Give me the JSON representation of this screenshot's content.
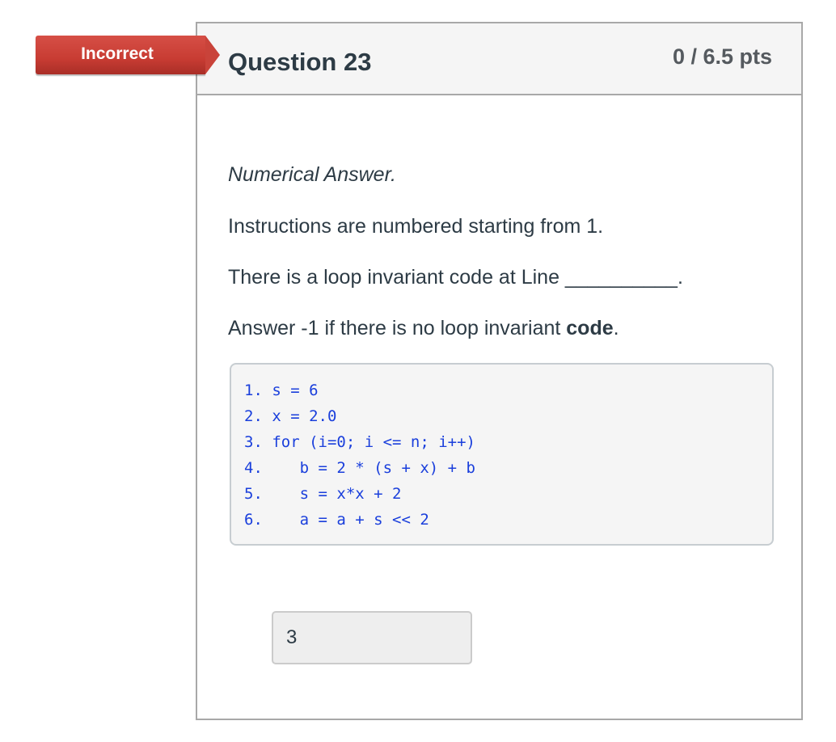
{
  "status": {
    "label": "Incorrect",
    "color": "#c83c33"
  },
  "question": {
    "title": "Question 23",
    "points": "0 / 6.5 pts",
    "type_label": "Numerical Answer.",
    "instructions": "Instructions are numbered starting from 1.",
    "prompt": "There is a loop invariant code at Line __________.",
    "note_prefix": "Answer -1 if there is no loop invariant ",
    "note_bold": "code",
    "note_suffix": ".",
    "code_lines": [
      "1. s = 6",
      "2. x = 2.0",
      "3. for (i=0; i <= n; i++)",
      "4.    b = 2 * (s + x) + b",
      "5.    s = x*x + 2",
      "6.    a = a + s << 2"
    ],
    "answer": {
      "value": "3"
    }
  }
}
